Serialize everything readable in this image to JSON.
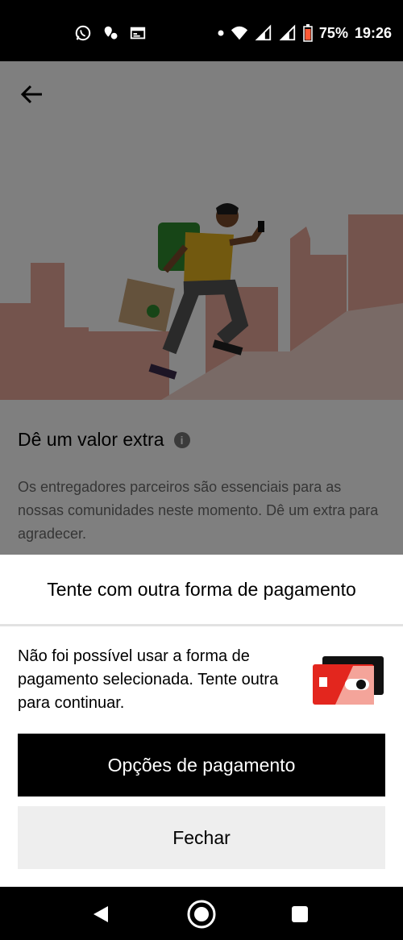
{
  "status_bar": {
    "battery": "75%",
    "time": "19:26",
    "left_icons": [
      "whatsapp-icon",
      "location-pin-icon",
      "calendar-card-icon"
    ],
    "right_icons": [
      "dot-icon",
      "wifi-icon",
      "signal-icon",
      "signal-icon",
      "battery-icon"
    ]
  },
  "page": {
    "tip_title": "Dê um valor extra",
    "tip_description": "Os entregadores parceiros são essenciais para as nossas comunidades neste momento. Dê um extra para agradecer."
  },
  "sheet": {
    "title": "Tente com outra forma de pagamento",
    "message": "Não foi possível usar a forma de pagamento selecionada. Tente outra para continuar.",
    "primary_button": "Opções de pagamento",
    "secondary_button": "Fechar"
  },
  "colors": {
    "card_red": "#e3261e",
    "card_black": "#111111",
    "courier_shirt": "#e5b21f",
    "courier_bag": "#2e8b2e",
    "city_pink": "#e9a89a"
  }
}
